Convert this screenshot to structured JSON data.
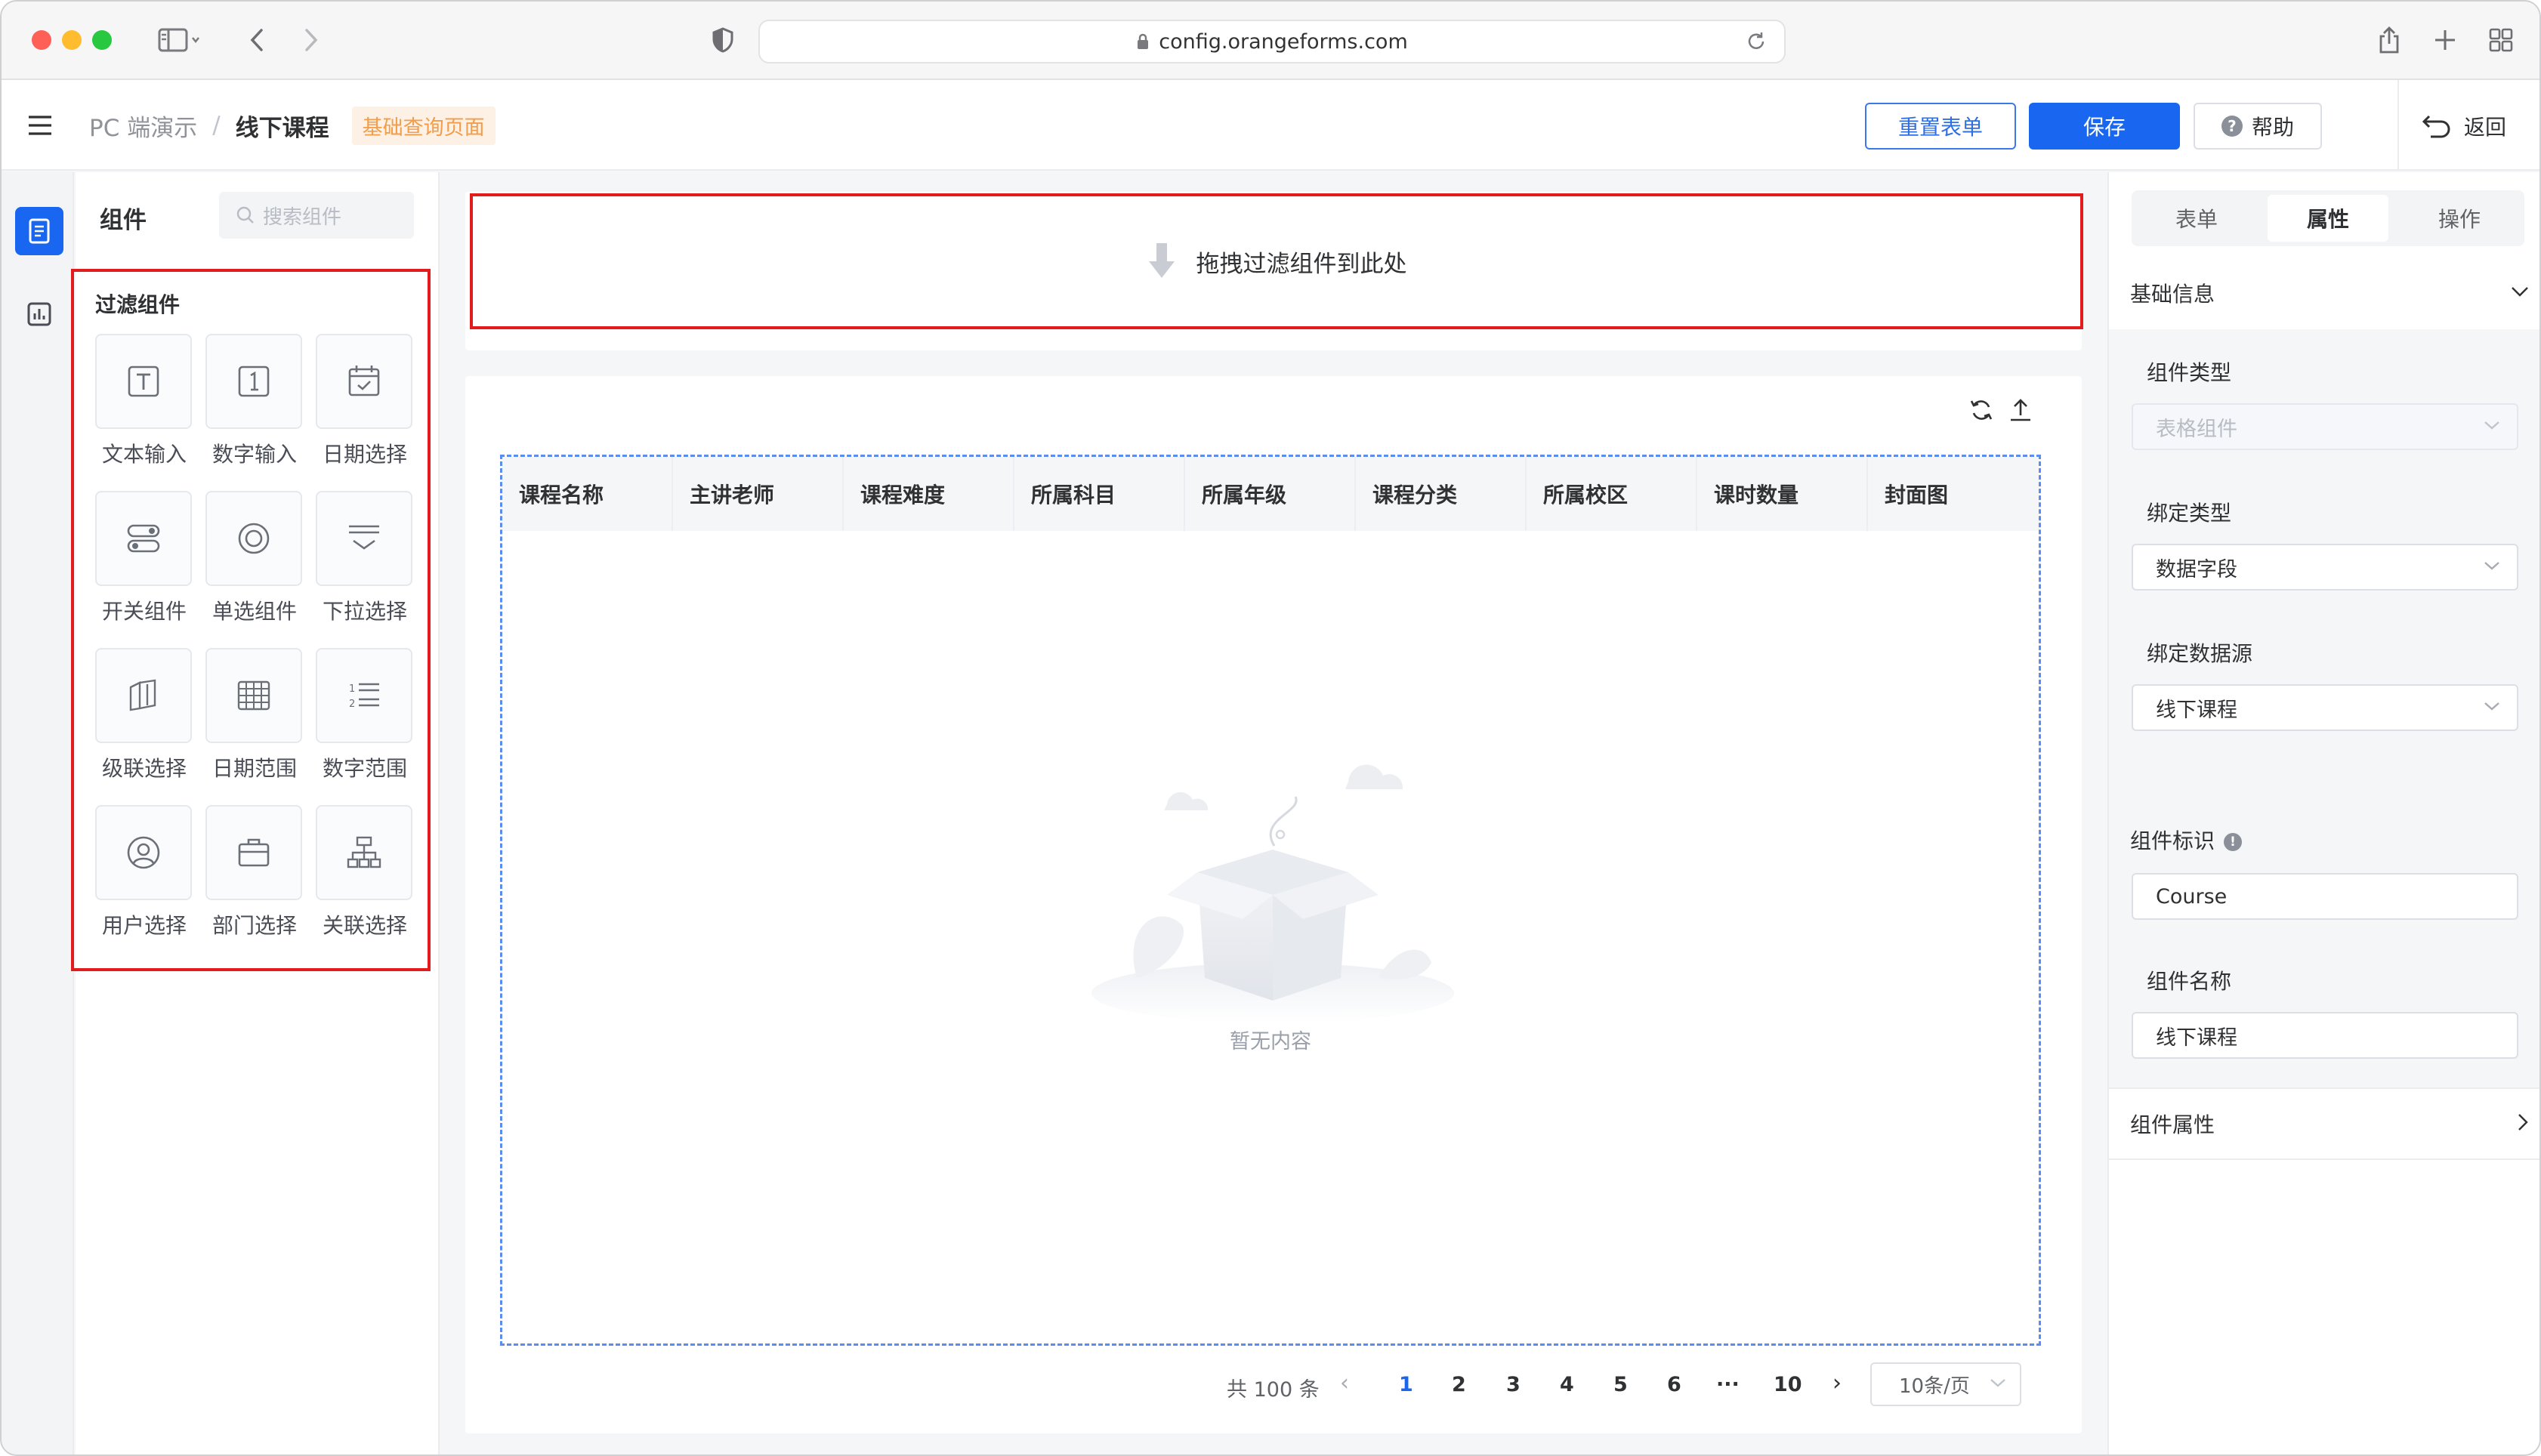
{
  "browser": {
    "url": "config.orangeforms.com"
  },
  "header": {
    "breadcrumb_root": "PC 端演示",
    "breadcrumb_sep": "/",
    "breadcrumb_current": "线下课程",
    "page_badge": "基础查询页面",
    "reset_label": "重置表单",
    "save_label": "保存",
    "help_label": "帮助",
    "back_label": "返回"
  },
  "components_panel": {
    "title": "组件",
    "search_placeholder": "搜索组件",
    "group_title": "过滤组件",
    "items": [
      {
        "label": "文本输入",
        "icon": "text-input-icon"
      },
      {
        "label": "数字输入",
        "icon": "number-input-icon"
      },
      {
        "label": "日期选择",
        "icon": "calendar-icon"
      },
      {
        "label": "开关组件",
        "icon": "switch-icon"
      },
      {
        "label": "单选组件",
        "icon": "radio-icon"
      },
      {
        "label": "下拉选择",
        "icon": "dropdown-icon"
      },
      {
        "label": "级联选择",
        "icon": "cascade-icon"
      },
      {
        "label": "日期范围",
        "icon": "date-range-icon"
      },
      {
        "label": "数字范围",
        "icon": "number-range-icon"
      },
      {
        "label": "用户选择",
        "icon": "user-icon"
      },
      {
        "label": "部门选择",
        "icon": "briefcase-icon"
      },
      {
        "label": "关联选择",
        "icon": "org-tree-icon"
      }
    ]
  },
  "canvas": {
    "drop_hint": "拖拽过滤组件到此处",
    "table_columns": [
      "课程名称",
      "主讲老师",
      "课程难度",
      "所属科目",
      "所属年级",
      "课程分类",
      "所属校区",
      "课时数量",
      "封面图"
    ],
    "empty_text": "暂无内容",
    "pagination": {
      "total_text": "共 100 条",
      "pages": [
        "1",
        "2",
        "3",
        "4",
        "5",
        "6"
      ],
      "ellipsis": "···",
      "last_page": "10",
      "current_page": "1",
      "page_size": "10条/页"
    }
  },
  "properties_panel": {
    "tabs": [
      "表单",
      "属性",
      "操作"
    ],
    "active_tab": "属性",
    "section_basic": "基础信息",
    "fields": {
      "component_type_label": "组件类型",
      "component_type_value": "表格组件",
      "bind_type_label": "绑定类型",
      "bind_type_value": "数据字段",
      "bind_source_label": "绑定数据源",
      "bind_source_value": "线下课程",
      "component_id_label": "组件标识",
      "component_id_value": "Course",
      "component_name_label": "组件名称",
      "component_name_value": "线下课程"
    },
    "section_props": "组件属性"
  },
  "colors": {
    "primary": "#1967f0",
    "highlight_border": "#e21c1c",
    "badge_bg": "#fdf0e4",
    "badge_text": "#f29d49"
  }
}
